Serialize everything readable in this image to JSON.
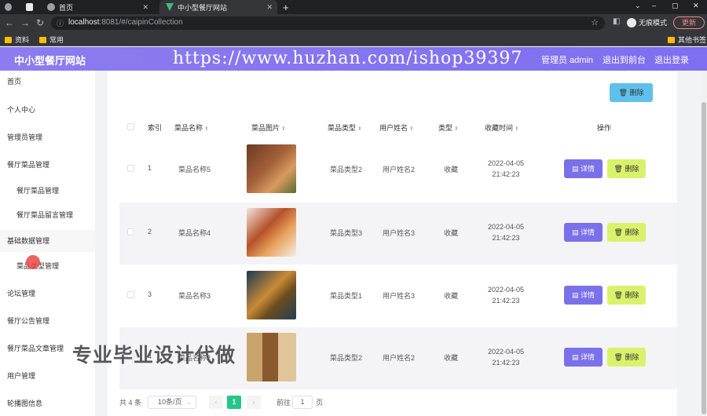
{
  "browser": {
    "tabs": [
      "首页",
      "中小型餐厅网站"
    ],
    "new_tab": "+",
    "url_host": "localhost",
    "url_path": ":8081/#/caipinCollection",
    "incognito_label": "无痕模式",
    "update_label": "更新",
    "bookmarks": [
      "资料",
      "常用"
    ],
    "other_bookmarks": "其他书签",
    "window_controls": [
      "⌄",
      "–",
      "▢",
      "✕"
    ]
  },
  "header": {
    "brand": "中小型餐厅网站",
    "user": "管理员 admin",
    "front_link": "退出到前台",
    "logout": "退出登录",
    "watermark": "https://www.huzhan.com/ishop39397"
  },
  "sidebar": {
    "items": [
      {
        "label": "首页",
        "level": "top"
      },
      {
        "label": "个人中心",
        "level": "top"
      },
      {
        "label": "管理员管理",
        "level": "top"
      },
      {
        "label": "餐厅菜品管理",
        "level": "top"
      },
      {
        "label": "餐厅菜品管理",
        "level": "sub"
      },
      {
        "label": "餐厅菜品留言管理",
        "level": "sub"
      },
      {
        "label": "基础数据管理",
        "level": "top"
      },
      {
        "label": "菜品类型管理",
        "level": "sub"
      },
      {
        "label": "论坛管理",
        "level": "top"
      },
      {
        "label": "餐厅公告管理",
        "level": "top"
      },
      {
        "label": "餐厅菜品文章管理",
        "level": "top"
      },
      {
        "label": "用户管理",
        "level": "top"
      },
      {
        "label": "轮播图信息",
        "level": "top"
      }
    ]
  },
  "toolbar": {
    "delete_label": "删除"
  },
  "table": {
    "headers": {
      "index": "索引",
      "name": "菜品名称",
      "image": "菜品图片",
      "type": "菜品类型",
      "user": "用户姓名",
      "kind": "类型",
      "time": "收藏时间",
      "actions": "操作"
    },
    "rows": [
      {
        "index": "1",
        "name": "菜品名称5",
        "type": "菜品类型2",
        "user": "用户姓名2",
        "kind": "收藏",
        "date": "2022-04-05",
        "clock": "21:42:23"
      },
      {
        "index": "2",
        "name": "菜品名称4",
        "type": "菜品类型3",
        "user": "用户姓名3",
        "kind": "收藏",
        "date": "2022-04-05",
        "clock": "21:42:23"
      },
      {
        "index": "3",
        "name": "菜品名称3",
        "type": "菜品类型1",
        "user": "用户姓名3",
        "kind": "收藏",
        "date": "2022-04-05",
        "clock": "21:42:23"
      },
      {
        "index": "4",
        "name": "菜品名称2",
        "type": "菜品类型2",
        "user": "用户姓名2",
        "kind": "收藏",
        "date": "2022-04-05",
        "clock": "21:42:23"
      }
    ],
    "detail_label": "详情",
    "delete_label": "删除"
  },
  "pagination": {
    "total": "共 4 条",
    "page_size": "10条/页",
    "current_page": "1",
    "goto_prefix": "前往",
    "goto_value": "1",
    "goto_suffix": "页"
  },
  "overlay": "专业毕业设计代做",
  "colors": {
    "header": "#7d6ff0",
    "detail": "#7a70ea",
    "delete": "#d9f26b",
    "top_delete": "#5ec1ec",
    "page_active": "#24c787"
  }
}
